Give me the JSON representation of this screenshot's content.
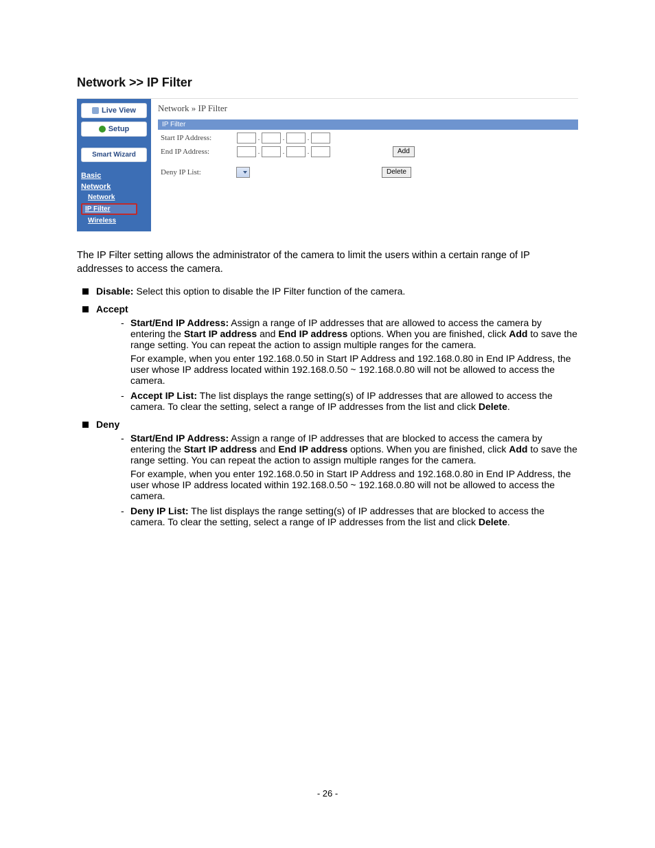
{
  "heading": "Network >> IP Filter",
  "ui": {
    "sidebar": {
      "live_view": "Live View",
      "setup": "Setup",
      "smart_wizard": "Smart Wizard",
      "basic": "Basic",
      "network": "Network",
      "sub_network": "Network",
      "sub_ip_filter": "IP Filter",
      "sub_wireless": "Wireless"
    },
    "main": {
      "breadcrumb": "Network » IP Filter",
      "section_header": "IP Filter",
      "start_ip": "Start IP Address:",
      "end_ip": "End IP Address:",
      "deny_list": "Deny IP List:",
      "add_btn": "Add",
      "delete_btn": "Delete"
    }
  },
  "intro": "The IP Filter setting allows the administrator of the camera to limit the users within a certain range of IP addresses to access the camera.",
  "items": {
    "disable_label": "Disable:",
    "disable_text": " Select this option to disable the IP Filter function of the camera.",
    "accept_label": "Accept",
    "accept_start_label": "Start/End IP Address:",
    "accept_start_text_a": " Assign a range of IP addresses that are allowed to access the camera by entering the ",
    "accept_start_bold1": "Start IP address",
    "accept_start_mid": " and ",
    "accept_start_bold2": "End IP address",
    "accept_start_text_b": " options. When you are finished, click ",
    "accept_start_bold3": "Add",
    "accept_start_text_c": " to save the range setting. You can repeat the action to assign multiple ranges for the camera.",
    "accept_example": "For example, when you enter 192.168.0.50 in Start IP Address and 192.168.0.80 in End IP Address, the user whose IP address located within 192.168.0.50 ~ 192.168.0.80 will not be allowed to access the camera.",
    "accept_list_label": "Accept IP List:",
    "accept_list_text_a": " The list displays the range setting(s) of IP addresses that are allowed to access the camera. To clear the setting, select a range of IP addresses from the list and click ",
    "accept_list_bold": "Delete",
    "accept_list_text_b": ".",
    "deny_label": "Deny",
    "deny_start_label": "Start/End IP Address:",
    "deny_start_text_a": " Assign a range of IP addresses that are blocked to access the camera by entering the ",
    "deny_start_bold1": "Start IP address",
    "deny_start_mid": " and ",
    "deny_start_bold2": "End IP address",
    "deny_start_text_b": " options. When you are finished, click ",
    "deny_start_bold3": "Add",
    "deny_start_text_c": " to save the range setting. You can repeat the action to assign multiple ranges for the camera.",
    "deny_example": "For example, when you enter 192.168.0.50 in Start IP Address and 192.168.0.80 in End IP Address, the user whose IP address located within 192.168.0.50 ~ 192.168.0.80 will not be allowed to access the camera.",
    "deny_list_label": "Deny IP List:",
    "deny_list_text_a": " The list displays the range setting(s) of IP addresses that are blocked to access the camera. To clear the setting, select a range of IP addresses from the list and click ",
    "deny_list_bold": "Delete",
    "deny_list_text_b": "."
  },
  "page_num": "- 26 -"
}
